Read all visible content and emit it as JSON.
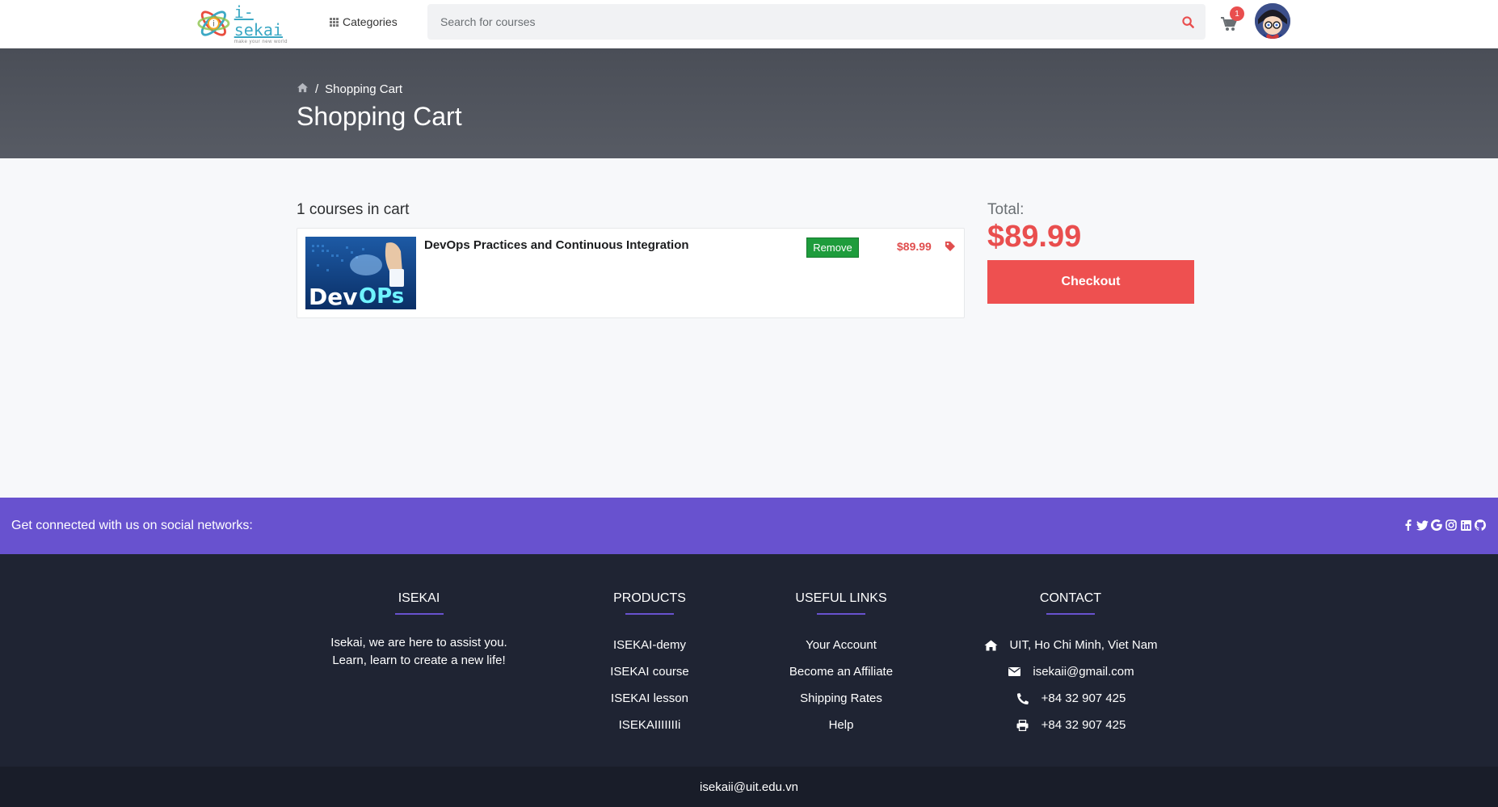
{
  "navbar": {
    "logo_text": "i-sekai",
    "logo_tagline": "make your new world",
    "categories_label": "Categories",
    "search_placeholder": "Search for courses",
    "cart_count": "1"
  },
  "header": {
    "breadcrumb_current": "Shopping Cart",
    "title": "Shopping Cart"
  },
  "cart": {
    "count_text": "1 courses in cart",
    "items": [
      {
        "title": "DevOps Practices and Continuous Integration",
        "thumb_text_1": "Dev",
        "thumb_text_2": "OPs",
        "remove_label": "Remove",
        "price": "$89.99"
      }
    ],
    "total_label": "Total:",
    "total_amount": "$89.99",
    "checkout_label": "Checkout"
  },
  "social": {
    "text": "Get connected with us on social networks:",
    "icons": [
      "facebook-icon",
      "twitter-icon",
      "google-icon",
      "instagram-icon",
      "linkedin-icon",
      "github-icon"
    ]
  },
  "footer": {
    "isekai": {
      "heading": "ISEKAI",
      "desc_line1": "Isekai, we are here to assist you.",
      "desc_line2": "Learn, learn to create a new life!"
    },
    "products": {
      "heading": "PRODUCTS",
      "items": [
        "ISEKAI-demy",
        "ISEKAI course",
        "ISEKAI lesson",
        "ISEKAIIIIIIIi"
      ]
    },
    "useful_links": {
      "heading": "USEFUL LINKS",
      "items": [
        "Your Account",
        "Become an Affiliate",
        "Shipping Rates",
        "Help"
      ]
    },
    "contact": {
      "heading": "CONTACT",
      "address": "UIT, Ho Chi Minh, Viet Nam",
      "email": "isekaii@gmail.com",
      "phone": "+84 32 907 425",
      "fax": "+84 32 907 425"
    },
    "bottom_email": "isekaii@uit.edu.vn"
  },
  "colors": {
    "accent_red": "#e94e4e",
    "purple": "#6852cf",
    "remove_green": "#1e9c3c",
    "footer_bg": "#1f2433"
  }
}
